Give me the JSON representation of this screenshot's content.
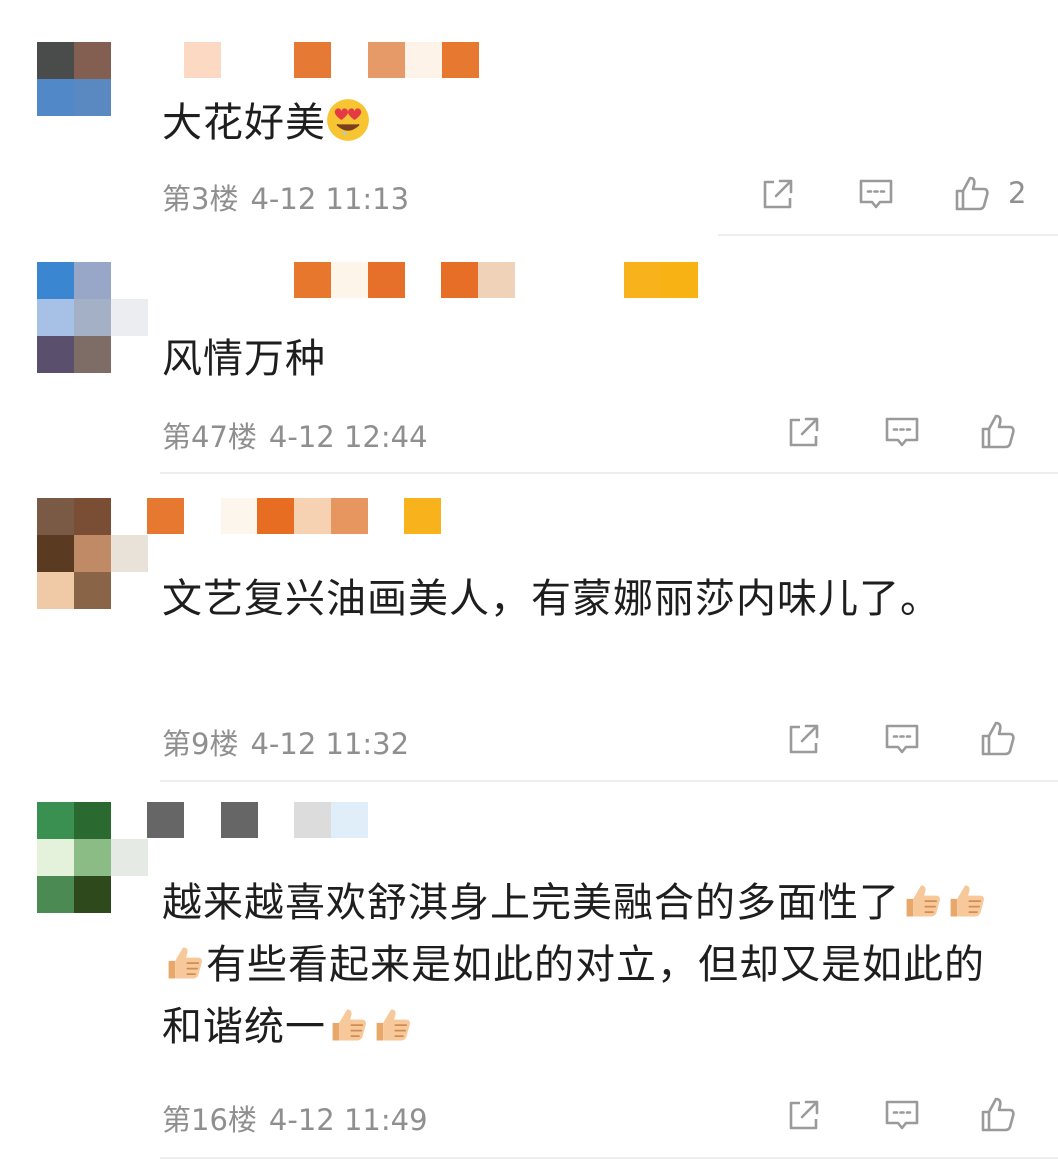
{
  "comments": [
    {
      "text": "大花好美",
      "emoji": "heart-eyes-emoji",
      "floor": "第3楼",
      "time": "4-12 11:13",
      "likes": "2"
    },
    {
      "text": "风情万种",
      "floor": "第47楼",
      "time": "4-12 12:44",
      "likes": ""
    },
    {
      "text": "文艺复兴油画美人，有蒙娜丽莎内味儿了。",
      "floor": "第9楼",
      "time": "4-12 11:32",
      "likes": ""
    },
    {
      "text_1": "越来越喜欢舒淇身上完美融合的多面性了",
      "text_2": "有些看起来是如此的对立，但却又是如此的和谐统一",
      "emoji": "thumbs-up-emoji",
      "floor": "第16楼",
      "time": "4-12 11:49",
      "likes": ""
    }
  ],
  "icons": {
    "share": "share-icon",
    "reply": "reply-icon",
    "like": "thumbs-up-icon"
  },
  "colors": {
    "text": "#1e1e1e",
    "meta": "#8f8f8f",
    "icon": "#9a9a9a",
    "divider": "#eeeeee"
  }
}
